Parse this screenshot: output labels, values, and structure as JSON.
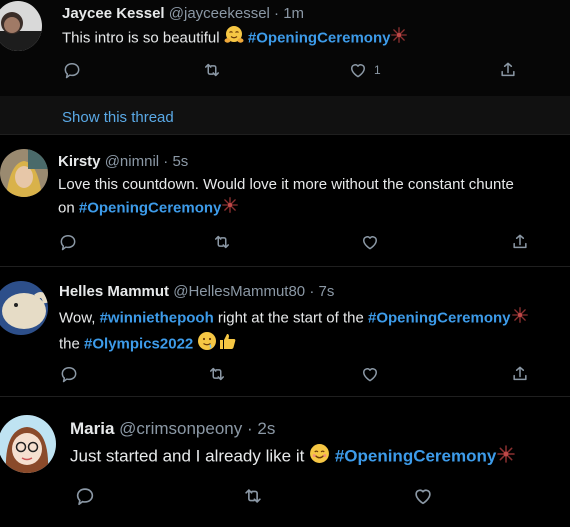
{
  "tweets": [
    {
      "name": "Jaycee Kessel",
      "handle": "@jayceekessel",
      "separator": "·",
      "time": "1m",
      "text_before": "This intro is so beautiful",
      "hashtag1": "#OpeningCeremony",
      "likes": "1"
    },
    {
      "name": "Kirsty",
      "handle": "@nimnil",
      "separator": "·",
      "time": "5s",
      "line1": "Love this countdown. Would love it more without the constant chunte",
      "line2_before": "on ",
      "hashtag1": "#OpeningCeremony"
    },
    {
      "name": "Helles Mammut",
      "handle": "@HellesMammut80",
      "separator": "·",
      "time": "7s",
      "line1_before": "Wow, ",
      "hashtag1": "#winniethepooh",
      "line1_middle": " right at the start of the ",
      "hashtag2": "#OpeningCeremony",
      "line2_before": "the ",
      "hashtag3": "#Olympics2022"
    },
    {
      "name": "Maria",
      "handle": "@crimsonpeony",
      "separator": "·",
      "time": "2s",
      "text_before": "Just started and I already like it",
      "hashtag1": "#OpeningCeremony"
    }
  ],
  "show_thread": "Show this thread",
  "colors": {
    "background": "#000000",
    "link": "#3d9be9",
    "muted": "#8b98a5",
    "text": "#e7e9ea"
  },
  "icons": [
    "reply-icon",
    "retweet-icon",
    "like-icon",
    "share-icon",
    "olympic-fireworks-icon",
    "smiling-blush-emoji",
    "drooling-face-emoji",
    "thumbs-up-emoji",
    "hugging-face-emoji"
  ]
}
